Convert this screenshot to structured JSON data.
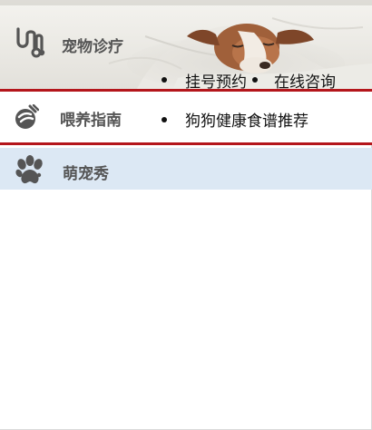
{
  "menu": {
    "clinic": {
      "title": "宠物诊疗",
      "icon": "stethoscope-icon",
      "links": [
        "挂号预约",
        "在线咨询"
      ]
    },
    "feeding": {
      "title": "喂养指南",
      "icon": "bowl-icon",
      "links": [
        "狗狗健康食谱推荐"
      ]
    },
    "show": {
      "title": "萌宠秀",
      "icon": "paw-icon"
    }
  },
  "colors": {
    "active_border": "#b4161b",
    "selected_row_bg": "#dce8f4",
    "icon_gray": "#555555"
  }
}
